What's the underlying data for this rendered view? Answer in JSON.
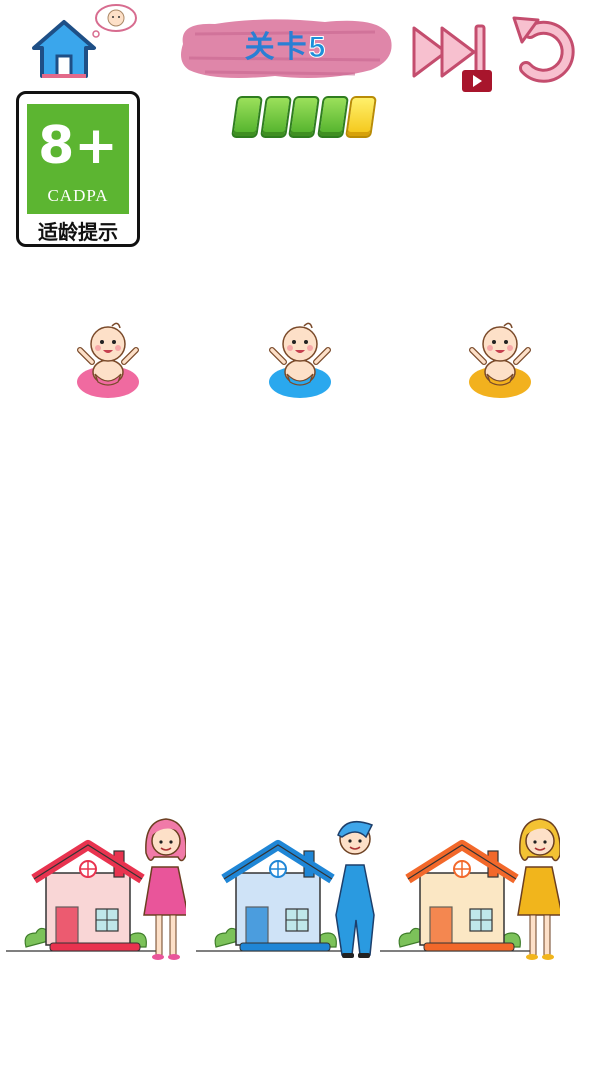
{
  "header": {
    "level_label": "关卡",
    "level_number": "5",
    "home_icon": "home-icon",
    "skip_icon": "skip-video-icon",
    "restart_icon": "restart-icon"
  },
  "progress": {
    "filled": 4,
    "total": 5,
    "current": 5
  },
  "age_rating": {
    "number": "8+",
    "org": "CADPA",
    "label": "适龄提示"
  },
  "babies": [
    {
      "color": "#f06aa0",
      "name": "pink"
    },
    {
      "color": "#2aa8ee",
      "name": "blue"
    },
    {
      "color": "#f2b11e",
      "name": "orange"
    }
  ],
  "families": [
    {
      "roof": "#e8334f",
      "wall": "#f9d6d6",
      "person": "pink-woman"
    },
    {
      "roof": "#1f86d6",
      "wall": "#cfe3f7",
      "person": "blue-man"
    },
    {
      "roof": "#f2682a",
      "wall": "#fbe7c4",
      "person": "yellow-woman"
    }
  ]
}
